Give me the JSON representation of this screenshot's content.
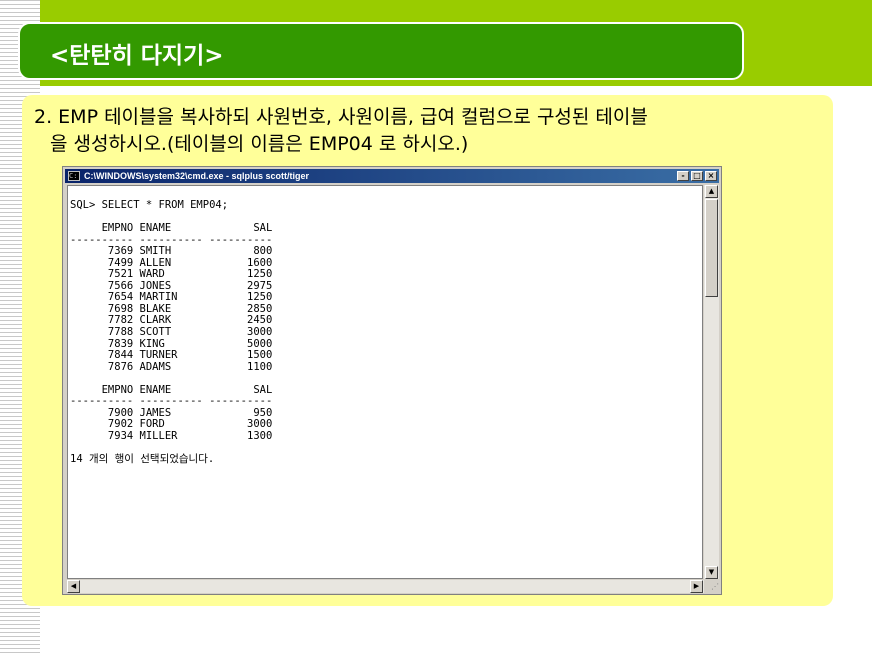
{
  "slide": {
    "title": "<탄탄히 다지기>",
    "instruction_line1": "2. EMP 테이블을 복사하되 사원번호, 사원이름, 급여 컬럼으로 구성된 테이블",
    "instruction_line2": "을 생성하시오.(테이블의 이름은 EMP04 로 하시오.)"
  },
  "console": {
    "title": "C:\\WINDOWS\\system32\\cmd.exe - sqlplus scott/tiger",
    "minimize_label": "-",
    "maximize_label": "□",
    "close_label": "×",
    "query": "SQL> SELECT * FROM EMP04;",
    "columns": [
      "EMPNO",
      "ENAME",
      "SAL"
    ],
    "separator": "---------- ---------- ----------",
    "rows_page1": [
      [
        "7369",
        "SMITH",
        "800"
      ],
      [
        "7499",
        "ALLEN",
        "1600"
      ],
      [
        "7521",
        "WARD",
        "1250"
      ],
      [
        "7566",
        "JONES",
        "2975"
      ],
      [
        "7654",
        "MARTIN",
        "1250"
      ],
      [
        "7698",
        "BLAKE",
        "2850"
      ],
      [
        "7782",
        "CLARK",
        "2450"
      ],
      [
        "7788",
        "SCOTT",
        "3000"
      ],
      [
        "7839",
        "KING",
        "5000"
      ],
      [
        "7844",
        "TURNER",
        "1500"
      ],
      [
        "7876",
        "ADAMS",
        "1100"
      ]
    ],
    "rows_page2": [
      [
        "7900",
        "JAMES",
        "950"
      ],
      [
        "7902",
        "FORD",
        "3000"
      ],
      [
        "7934",
        "MILLER",
        "1300"
      ]
    ],
    "footer": "14 개의 행이 선택되었습니다.",
    "output_text": "SQL> SELECT * FROM EMP04;\n\n     EMPNO ENAME             SAL\n---------- ---------- ----------\n      7369 SMITH             800\n      7499 ALLEN            1600\n      7521 WARD             1250\n      7566 JONES            2975\n      7654 MARTIN           1250\n      7698 BLAKE            2850\n      7782 CLARK            2450\n      7788 SCOTT            3000\n      7839 KING             5000\n      7844 TURNER           1500\n      7876 ADAMS            1100\n\n     EMPNO ENAME             SAL\n---------- ---------- ----------\n      7900 JAMES             950\n      7902 FORD             3000\n      7934 MILLER           1300\n\n14 개의 행이 선택되었습니다."
  },
  "colors": {
    "top_band": "#99cc00",
    "title_panel": "#339900",
    "content_panel": "#ffff99",
    "console_titlebar": "#0a246a"
  },
  "icons": [
    "cmd-icon",
    "minimize-icon",
    "maximize-icon",
    "close-icon",
    "scroll-up-icon",
    "scroll-down-icon",
    "scroll-left-icon",
    "scroll-right-icon",
    "resize-grip-icon"
  ]
}
